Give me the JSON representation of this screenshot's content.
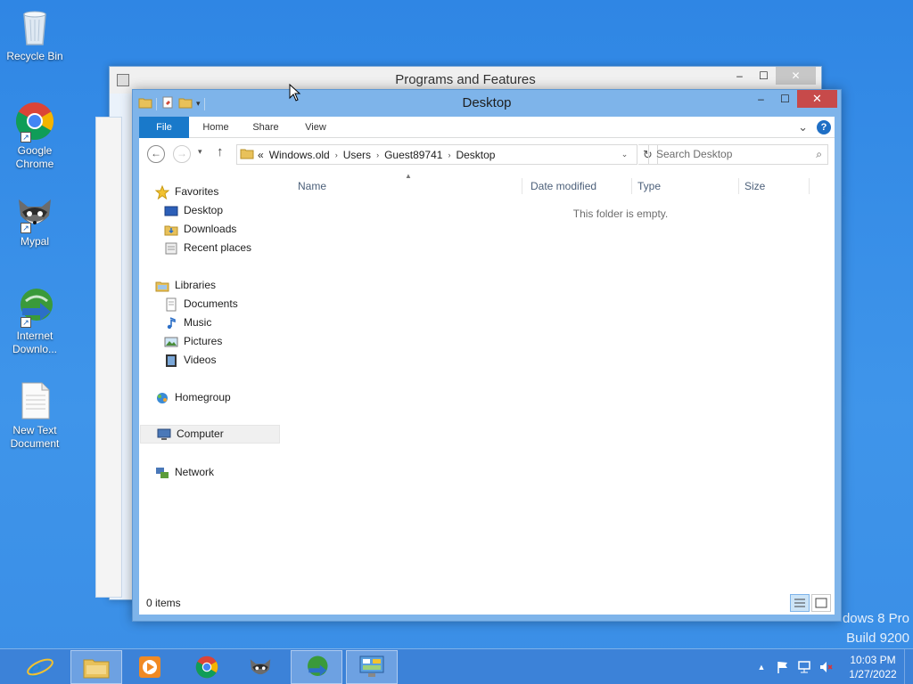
{
  "desktop": {
    "icons": [
      {
        "label": "Recycle Bin",
        "icon": "recycle-bin-icon"
      },
      {
        "label": "Google Chrome",
        "icon": "chrome-icon"
      },
      {
        "label": "Mypal",
        "icon": "mypal-icon"
      },
      {
        "label": "Internet Downlo...",
        "icon": "internet-download-manager-icon"
      },
      {
        "label": "New Text Document",
        "icon": "text-document-icon"
      }
    ],
    "watermark_line1": "dows 8 Pro",
    "watermark_line2": "Build 9200"
  },
  "back_window": {
    "title": "Programs and Features",
    "minimize": "–",
    "maximize": "☐",
    "close": "✕"
  },
  "explorer": {
    "title": "Desktop",
    "minimize": "–",
    "maximize": "☐",
    "close": "✕",
    "ribbon_tabs": [
      "File",
      "Home",
      "Share",
      "View"
    ],
    "expand_ribbon": "⌄",
    "help": "?",
    "nav": {
      "back": "←",
      "forward": "→",
      "recent": "▾",
      "up": "↑"
    },
    "address": {
      "overflow": "«",
      "segments": [
        "Windows.old",
        "Users",
        "Guest89741",
        "Desktop"
      ],
      "separator": "›",
      "dropdown": "⌄",
      "refresh": "↻"
    },
    "search_placeholder": "Search Desktop",
    "search_icon": "⌕",
    "navpane": {
      "favorites": {
        "label": "Favorites",
        "items": [
          "Desktop",
          "Downloads",
          "Recent places"
        ]
      },
      "libraries": {
        "label": "Libraries",
        "items": [
          "Documents",
          "Music",
          "Pictures",
          "Videos"
        ]
      },
      "homegroup": "Homegroup",
      "computer": "Computer",
      "network": "Network"
    },
    "columns": [
      "Name",
      "Date modified",
      "Type",
      "Size"
    ],
    "sort_indicator": "▲",
    "empty_message": "This folder is empty.",
    "status": "0 items"
  },
  "taskbar": {
    "items": [
      "internet-explorer-icon",
      "file-explorer-icon",
      "media-player-icon",
      "chrome-icon",
      "mypal-icon",
      "internet-download-manager-icon",
      "control-panel-icon"
    ],
    "tray_chevron": "▲",
    "time": "10:03 PM",
    "date": "1/27/2022"
  },
  "colors": {
    "desktop": "#3a8ee6",
    "window_frame": "#7eb4ea",
    "close_button": "#c74a4a",
    "file_tab": "#1979ca"
  }
}
